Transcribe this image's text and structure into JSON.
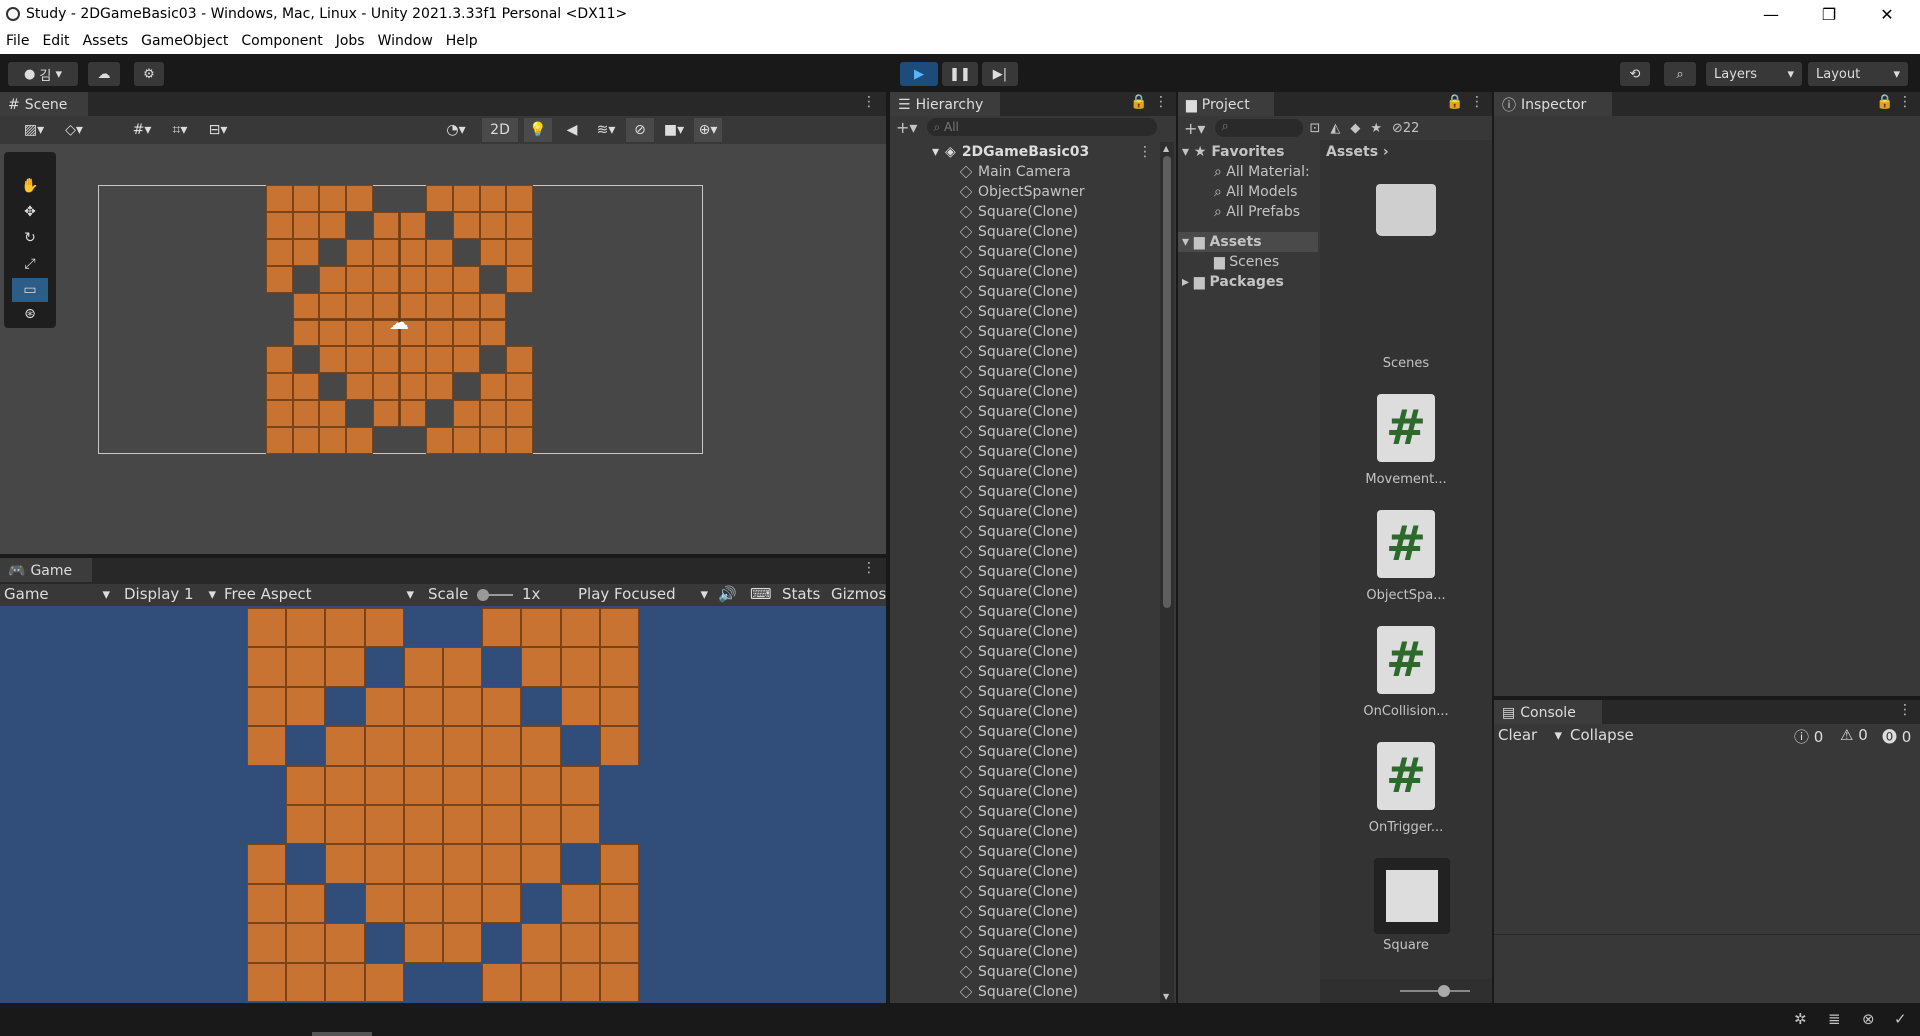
{
  "window": {
    "title": "Study - 2DGameBasic03 - Windows, Mac, Linux - Unity 2021.3.33f1 Personal <DX11>",
    "minimize": "—",
    "maximize": "❐",
    "close": "✕"
  },
  "menu": [
    "File",
    "Edit",
    "Assets",
    "GameObject",
    "Component",
    "Jobs",
    "Window",
    "Help"
  ],
  "toolbar": {
    "account_label": "김",
    "layers_label": "Layers",
    "layout_label": "Layout"
  },
  "scene": {
    "tab_label": "Scene",
    "mode_2d": "2D"
  },
  "game": {
    "tab_label": "Game",
    "view_dropdown": "Game",
    "display": "Display 1",
    "aspect": "Free Aspect",
    "scale_label": "Scale",
    "scale_value": "1x",
    "play_mode": "Play Focused",
    "stats": "Stats",
    "gizmos": "Gizmos"
  },
  "hierarchy": {
    "tab_label": "Hierarchy",
    "search_placeholder": "All",
    "scene_name": "2DGameBasic03",
    "items": [
      "Main Camera",
      "ObjectSpawner",
      "Square(Clone)",
      "Square(Clone)",
      "Square(Clone)",
      "Square(Clone)",
      "Square(Clone)",
      "Square(Clone)",
      "Square(Clone)",
      "Square(Clone)",
      "Square(Clone)",
      "Square(Clone)",
      "Square(Clone)",
      "Square(Clone)",
      "Square(Clone)",
      "Square(Clone)",
      "Square(Clone)",
      "Square(Clone)",
      "Square(Clone)",
      "Square(Clone)",
      "Square(Clone)",
      "Square(Clone)",
      "Square(Clone)",
      "Square(Clone)",
      "Square(Clone)",
      "Square(Clone)",
      "Square(Clone)",
      "Square(Clone)",
      "Square(Clone)",
      "Square(Clone)",
      "Square(Clone)",
      "Square(Clone)",
      "Square(Clone)",
      "Square(Clone)",
      "Square(Clone)",
      "Square(Clone)",
      "Square(Clone)",
      "Square(Clone)",
      "Square(Clone)",
      "Square(Clone)",
      "Square(Clone)",
      "Square(Clone)"
    ]
  },
  "project": {
    "tab_label": "Project",
    "hidden_count": "22",
    "favorites_label": "Favorites",
    "favorites": [
      "All Material:",
      "All Models",
      "All Prefabs"
    ],
    "assets_label": "Assets",
    "scenes_label": "Scenes",
    "packages_label": "Packages",
    "breadcrumb": "Assets",
    "grid_items": [
      "Scenes",
      "Movement...",
      "ObjectSpa...",
      "OnCollision...",
      "OnTrigger...",
      "Square"
    ]
  },
  "inspector": {
    "tab_label": "Inspector"
  },
  "console": {
    "tab_label": "Console",
    "clear": "Clear",
    "collapse": "Collapse",
    "info_count": "0",
    "warn_count": "0",
    "error_count": "0"
  },
  "colors": {
    "tile": "#c87332",
    "game_bg": "#314d79",
    "scene_bg": "#474747",
    "editor_bg": "#383838"
  },
  "tile_pattern": [
    "1111001111",
    "1110110111",
    "1101111011",
    "1011111101",
    "0111111110",
    "0111111110",
    "1011111101",
    "1101111011",
    "1110110111",
    "1111001111"
  ]
}
